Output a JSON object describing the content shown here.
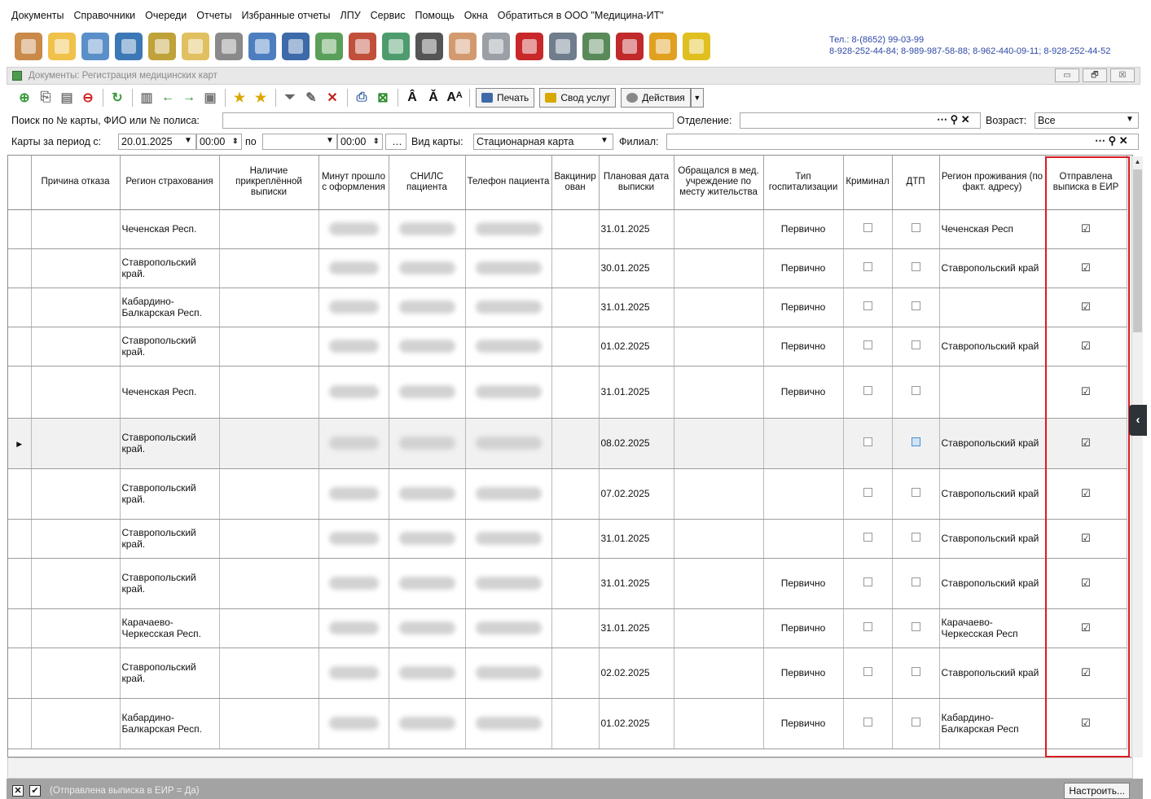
{
  "menu": [
    "Документы",
    "Справочники",
    "Очереди",
    "Отчеты",
    "Избранные отчеты",
    "ЛПУ",
    "Сервис",
    "Помощь",
    "Окна",
    "Обратиться в ООО \"Медицина-ИТ\""
  ],
  "icons": [
    {
      "name": "doctor-icon",
      "color": "#c98a4a"
    },
    {
      "name": "notepad-icon",
      "color": "#f0c24b"
    },
    {
      "name": "cabinet-icon",
      "color": "#5b8fc9"
    },
    {
      "name": "id-card-icon",
      "color": "#3c78b5"
    },
    {
      "name": "transfer-icon",
      "color": "#c0a23a"
    },
    {
      "name": "write-icon",
      "color": "#e0c060"
    },
    {
      "name": "syringe-icon",
      "color": "#8a8a8a"
    },
    {
      "name": "calendar-icon",
      "color": "#4d7fc0"
    },
    {
      "name": "lab-icon",
      "color": "#3d6aa8"
    },
    {
      "name": "medkit-icon",
      "color": "#5aa05a"
    },
    {
      "name": "books-icon",
      "color": "#c0503c"
    },
    {
      "name": "pills-icon",
      "color": "#4e9c6e"
    },
    {
      "name": "scanner-icon",
      "color": "#555555"
    },
    {
      "name": "nurse-icon",
      "color": "#d39a70"
    },
    {
      "name": "pen-icon",
      "color": "#9aa0a6"
    },
    {
      "name": "book-red-icon",
      "color": "#c8282a"
    },
    {
      "name": "schedule-icon",
      "color": "#6f7d8c"
    },
    {
      "name": "cabinet-list-icon",
      "color": "#5a8a5a"
    },
    {
      "name": "profile-red-icon",
      "color": "#c02a2a"
    },
    {
      "name": "lock-icon",
      "color": "#e0a020"
    },
    {
      "name": "alert-hat-icon",
      "color": "#e0c020"
    }
  ],
  "contact": {
    "line1": "Тел.: 8-(8652) 99-03-99",
    "line2": "8-928-252-44-84; 8-989-987-58-88; 8-962-440-09-11; 8-928-252-44-52"
  },
  "window": {
    "title": "Документы: Регистрация медицинских карт",
    "min": "▭",
    "restore": "🗗",
    "close": "☒"
  },
  "toolbar": {
    "print_label": "Печать",
    "services_label": "Свод услуг",
    "actions_label": "Действия",
    "font_labels": [
      "Â",
      "Ǎ",
      "Aᴬ"
    ]
  },
  "search": {
    "label": "Поиск по № карты, ФИО или № полиса:",
    "value": "",
    "department_label": "Отделение:",
    "department_value": "",
    "age_label": "Возраст:",
    "age_value": "Все"
  },
  "period": {
    "label": "Карты за период с:",
    "from_date": "20.01.2025",
    "from_time": "00:00",
    "to_label": "по",
    "to_date": "",
    "to_time": "00:00",
    "card_type_label": "Вид карты:",
    "card_type_value": "Стационарная карта",
    "branch_label": "Филиал:",
    "branch_value": ""
  },
  "table": {
    "columns": [
      "",
      "Причина отказа",
      "Регион страхования",
      "Наличие прикреплённой выписки",
      "Минут прошло с оформления",
      "СНИЛС пациента",
      "Телефон пациента",
      "Вакцинир ован",
      "Плановая дата выписки",
      "Обращался в мед. учреждение по месту жительства",
      "Тип госпитализации",
      "Криминал",
      "ДТП",
      "Регион проживания (по факт. адресу)",
      "Отправлена выписка в ЕИР"
    ],
    "rows": [
      {
        "region": "Чеченская Респ.",
        "planned_date": "31.01.2025",
        "hosp_type": "Первично",
        "live_region": "Чеченская Респ",
        "sent": "☑"
      },
      {
        "region": "Ставропольский край.",
        "planned_date": "30.01.2025",
        "hosp_type": "Первично",
        "live_region": "Ставропольский край",
        "sent": "☑"
      },
      {
        "region": "Кабардино-Балкарская Респ.",
        "planned_date": "31.01.2025",
        "hosp_type": "Первично",
        "live_region": "",
        "sent": "☑"
      },
      {
        "region": "Ставропольский край.",
        "planned_date": "01.02.2025",
        "hosp_type": "Первично",
        "live_region": "Ставропольский край",
        "sent": "☑"
      },
      {
        "region": "Чеченская Респ.",
        "planned_date": "31.01.2025",
        "hosp_type": "Первично",
        "live_region": "",
        "sent": "☑"
      },
      {
        "region": "Ставропольский край.",
        "planned_date": "08.02.2025",
        "hosp_type": "",
        "live_region": "Ставропольский край",
        "sent": "☑"
      },
      {
        "region": "Ставропольский край.",
        "planned_date": "07.02.2025",
        "hosp_type": "",
        "live_region": "Ставропольский край",
        "sent": "☑"
      },
      {
        "region": "Ставропольский край.",
        "planned_date": "31.01.2025",
        "hosp_type": "",
        "live_region": "Ставропольский край",
        "sent": "☑"
      },
      {
        "region": "Ставропольский край.",
        "planned_date": "31.01.2025",
        "hosp_type": "Первично",
        "live_region": "Ставропольский край",
        "sent": "☑"
      },
      {
        "region": "Карачаево-Черкесская Респ.",
        "planned_date": "31.01.2025",
        "hosp_type": "Первично",
        "live_region": "Карачаево-Черкесская Респ",
        "sent": "☑"
      },
      {
        "region": "Ставропольский край.",
        "planned_date": "02.02.2025",
        "hosp_type": "Первично",
        "live_region": "Ставропольский край",
        "sent": "☑"
      },
      {
        "region": "Кабардино-Балкарская Респ.",
        "planned_date": "01.02.2025",
        "hosp_type": "Первично",
        "live_region": "Кабардино-Балкарская Респ",
        "sent": "☑"
      }
    ]
  },
  "status": {
    "filter_text": "(Отправлена выписка в ЕИР = Да)",
    "setup_label": "Настроить..."
  },
  "colors": {
    "highlight": "#d81c22",
    "phone_blue": "#2d49a5"
  }
}
